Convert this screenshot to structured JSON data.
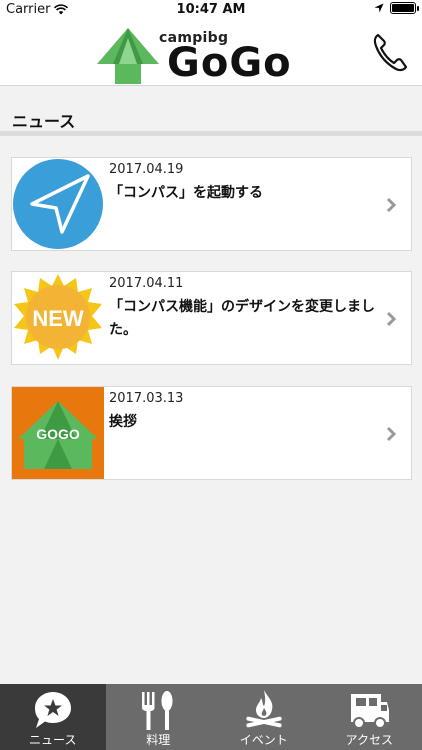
{
  "status_bar": {
    "carrier": "Carrier",
    "time": "10:47 AM"
  },
  "header": {
    "logo_small": "campibg",
    "logo_big": "GoGo"
  },
  "section": {
    "title": "ニュース"
  },
  "news": [
    {
      "date": "2017.04.19",
      "title": "「コンパス」を起動する",
      "thumb_icon": "compass-arrow-icon"
    },
    {
      "date": "2017.04.11",
      "title": "「コンパス機能」のデザインを変更しました。",
      "thumb_icon": "new-badge-icon",
      "badge_text": "NEW"
    },
    {
      "date": "2017.03.13",
      "title": "挨拶",
      "thumb_icon": "gogo-tent-icon",
      "badge_text": "GOGO"
    }
  ],
  "tabbar": {
    "items": [
      {
        "label": "ニュース",
        "icon": "news-bubble-icon",
        "active": true
      },
      {
        "label": "料理",
        "icon": "cutlery-icon",
        "active": false
      },
      {
        "label": "イベント",
        "icon": "campfire-icon",
        "active": false
      },
      {
        "label": "アクセス",
        "icon": "camper-van-icon",
        "active": false
      }
    ]
  },
  "colors": {
    "accent_blue": "#3a9fd8",
    "badge_yellow": "#f5c518",
    "orange": "#e8770e",
    "tent_green": "#4caf50",
    "tabbar": "#6b6b6b",
    "tabbar_active": "#3a3a3a"
  }
}
